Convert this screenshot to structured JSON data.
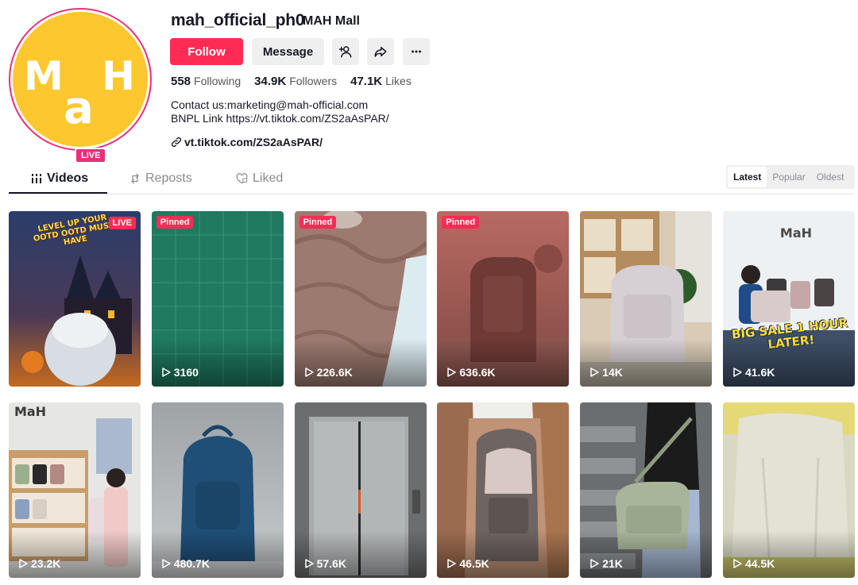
{
  "profile": {
    "username": "mah_official_ph0",
    "nickname": "MAH Mall",
    "live_badge": "LIVE",
    "avatar_text": "MaH"
  },
  "actions": {
    "follow": "Follow",
    "message": "Message",
    "icons": [
      "add-friend-icon",
      "share-icon",
      "more-icon"
    ]
  },
  "stats": [
    {
      "value": "558",
      "label": "Following"
    },
    {
      "value": "34.9K",
      "label": "Followers"
    },
    {
      "value": "47.1K",
      "label": "Likes"
    }
  ],
  "bio": {
    "line1": "Contact us:marketing@mah-official.com",
    "line2": "BNPL Link https://vt.tiktok.com/ZS2aAsPAR/",
    "link": "vt.tiktok.com/ZS2aAsPAR/"
  },
  "tabs": [
    {
      "label": "Videos",
      "active": true
    },
    {
      "label": "Reposts",
      "active": false
    },
    {
      "label": "Liked",
      "active": false
    }
  ],
  "sort": [
    {
      "label": "Latest",
      "active": true
    },
    {
      "label": "Popular",
      "active": false
    },
    {
      "label": "Oldest",
      "active": false
    }
  ],
  "videos": [
    {
      "views": "",
      "badge": "LIVE",
      "overlay": "LEVEL UP YOUR OOTD OOTD MUST HAVE"
    },
    {
      "views": "3160",
      "badge": "Pinned"
    },
    {
      "views": "226.6K",
      "badge": "Pinned"
    },
    {
      "views": "636.6K",
      "badge": "Pinned"
    },
    {
      "views": "14K"
    },
    {
      "views": "41.6K",
      "overlay": "BIG SALE 1 HOUR LATER!",
      "logo": "MaH"
    },
    {
      "views": "23.2K",
      "logo": "MaH"
    },
    {
      "views": "480.7K"
    },
    {
      "views": "57.6K"
    },
    {
      "views": "46.5K"
    },
    {
      "views": "21K"
    },
    {
      "views": "44.5K"
    }
  ],
  "colors": {
    "accent": "#fe2c55",
    "avatar_bg": "#fdc82f",
    "live_ring": "#e8307a"
  }
}
